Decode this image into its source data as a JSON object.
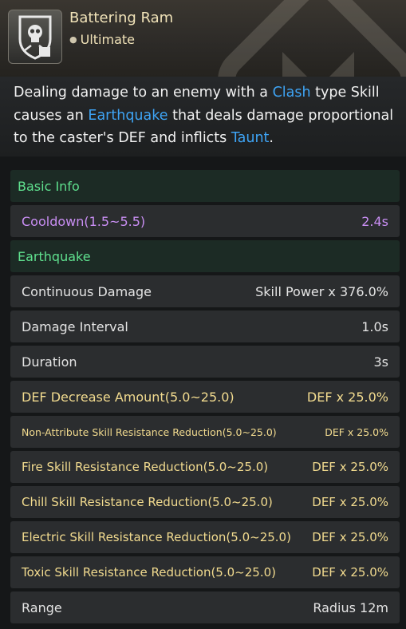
{
  "skill": {
    "name": "Battering Ram",
    "type": "Ultimate",
    "icon": "skull-shield-icon"
  },
  "description": {
    "p1": "Dealing damage to an enemy with a ",
    "k1": "Clash",
    "p2": " type Skill causes an ",
    "k2": "Earthquake",
    "p3": " that deals damage proportional to the caster's DEF and inflicts ",
    "k3": "Taunt",
    "p4": "."
  },
  "sections": {
    "basic_info": "Basic Info",
    "earthquake": "Earthquake"
  },
  "stats": {
    "cooldown": {
      "label": "Cooldown(1.5~5.5)",
      "value": "2.4s"
    },
    "continuous_damage": {
      "label": "Continuous Damage",
      "value": "Skill Power x 376.0%"
    },
    "damage_interval": {
      "label": "Damage Interval",
      "value": "1.0s"
    },
    "duration": {
      "label": "Duration",
      "value": "3s"
    },
    "def_decrease": {
      "label": "DEF Decrease Amount(5.0~25.0)",
      "value": "DEF x 25.0%"
    },
    "non_attribute_res": {
      "label": "Non-Attribute Skill Resistance Reduction(5.0~25.0)",
      "value": "DEF x 25.0%"
    },
    "fire_res": {
      "label": "Fire Skill Resistance Reduction(5.0~25.0)",
      "value": "DEF x 25.0%"
    },
    "chill_res": {
      "label": "Chill Skill Resistance Reduction(5.0~25.0)",
      "value": "DEF x 25.0%"
    },
    "electric_res": {
      "label": "Electric Skill Resistance Reduction(5.0~25.0)",
      "value": "DEF x 25.0%"
    },
    "toxic_res": {
      "label": "Toxic Skill Resistance Reduction(5.0~25.0)",
      "value": "DEF x 25.0%"
    },
    "range": {
      "label": "Range",
      "value": "Radius 12m"
    }
  },
  "colors": {
    "keyword": "#3ea4f5",
    "section_text": "#5fe08e",
    "cooldown": "#c98ef3",
    "gold": "#f2db8f"
  }
}
